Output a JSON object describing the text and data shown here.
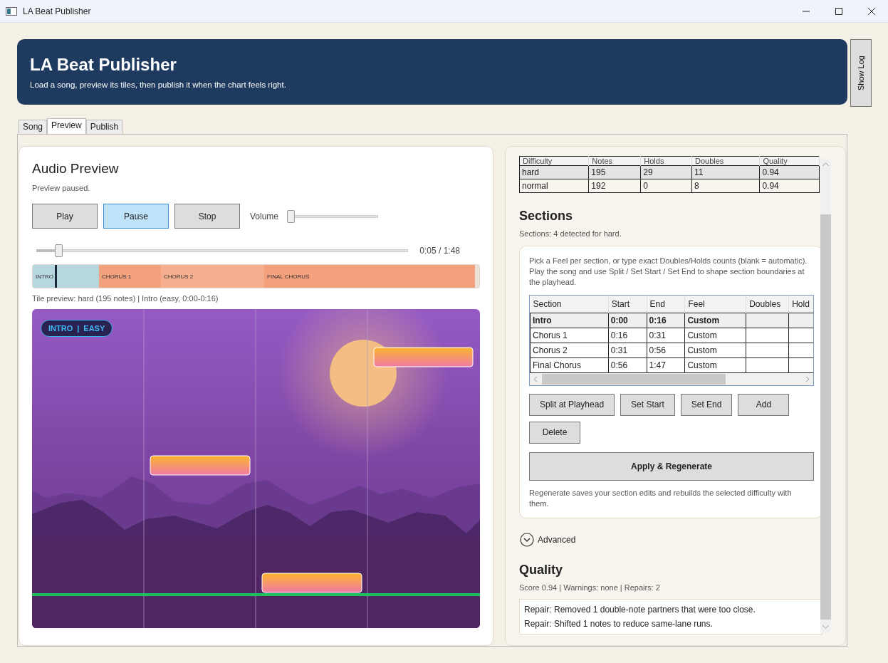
{
  "window": {
    "title": "LA Beat Publisher"
  },
  "header": {
    "title": "LA Beat Publisher",
    "subtitle": "Load a song, preview its tiles, then publish it when the chart feels right."
  },
  "show_log_button": "Show Log",
  "tabs": [
    {
      "label": "Song",
      "selected": false
    },
    {
      "label": "Preview",
      "selected": true
    },
    {
      "label": "Publish",
      "selected": false
    }
  ],
  "audio_preview": {
    "title": "Audio Preview",
    "status": "Preview paused.",
    "buttons": [
      {
        "label": "Play",
        "active": false
      },
      {
        "label": "Pause",
        "active": true
      },
      {
        "label": "Stop",
        "active": false
      }
    ],
    "volume": {
      "label": "Volume",
      "level": 0.0
    },
    "seek": {
      "level": 0.05,
      "time": "0:05 / 1:48"
    },
    "timeline": [
      {
        "label": "INTRO",
        "color": "#b7d7e0"
      },
      {
        "label": "CHORUS 1",
        "color": "#f3a07d"
      },
      {
        "label": "CHORUS 2",
        "color": "#f5ae8e"
      },
      {
        "label": "FINAL CHORUS",
        "color": "#f4a07c"
      }
    ],
    "tile_preview_caption": "Tile preview: hard (195 notes) | Intro (easy, 0:00-0:16)",
    "badge": {
      "section": "INTRO",
      "separator": "|",
      "difficulty": "EASY"
    }
  },
  "difficulty_table": {
    "columns": [
      "Difficulty",
      "Notes",
      "Holds",
      "Doubles",
      "Quality"
    ],
    "rows": [
      {
        "cells": [
          "hard",
          "195",
          "29",
          "11",
          "0.94"
        ],
        "selected": true
      },
      {
        "cells": [
          "normal",
          "192",
          "0",
          "8",
          "0.94"
        ],
        "selected": false
      }
    ]
  },
  "sections": {
    "title": "Sections",
    "summary": "Sections: 4 detected for hard.",
    "help": "Pick a Feel per section, or type exact Doubles/Holds counts (blank = automatic). Play the song and use Split / Set Start / Set End to shape section boundaries at the playhead.",
    "columns": [
      "Section",
      "Start",
      "End",
      "Feel",
      "Doubles",
      "Hold"
    ],
    "rows": [
      {
        "section": "Intro",
        "start": "0:00",
        "end": "0:16",
        "feel": "Custom",
        "selected": true
      },
      {
        "section": "Chorus 1",
        "start": "0:16",
        "end": "0:31",
        "feel": "Custom",
        "selected": false
      },
      {
        "section": "Chorus 2",
        "start": "0:31",
        "end": "0:56",
        "feel": "Custom",
        "selected": false
      },
      {
        "section": "Final Chorus",
        "start": "0:56",
        "end": "1:47",
        "feel": "Custom",
        "selected": false
      }
    ],
    "buttons": [
      "Split at Playhead",
      "Set Start",
      "Set End",
      "Add",
      "Delete"
    ],
    "apply_button": "Apply & Regenerate",
    "note": "Regenerate saves your section edits and rebuilds the selected difficulty with them."
  },
  "advanced": {
    "label": "Advanced",
    "expanded": false
  },
  "quality": {
    "title": "Quality",
    "summary": "Score 0.94 | Warnings: none | Repairs: 2",
    "log": [
      "Repair: Removed 1 double-note partners that were too close.",
      "Repair: Shifted 1 notes to reduce same-lane runs."
    ]
  }
}
